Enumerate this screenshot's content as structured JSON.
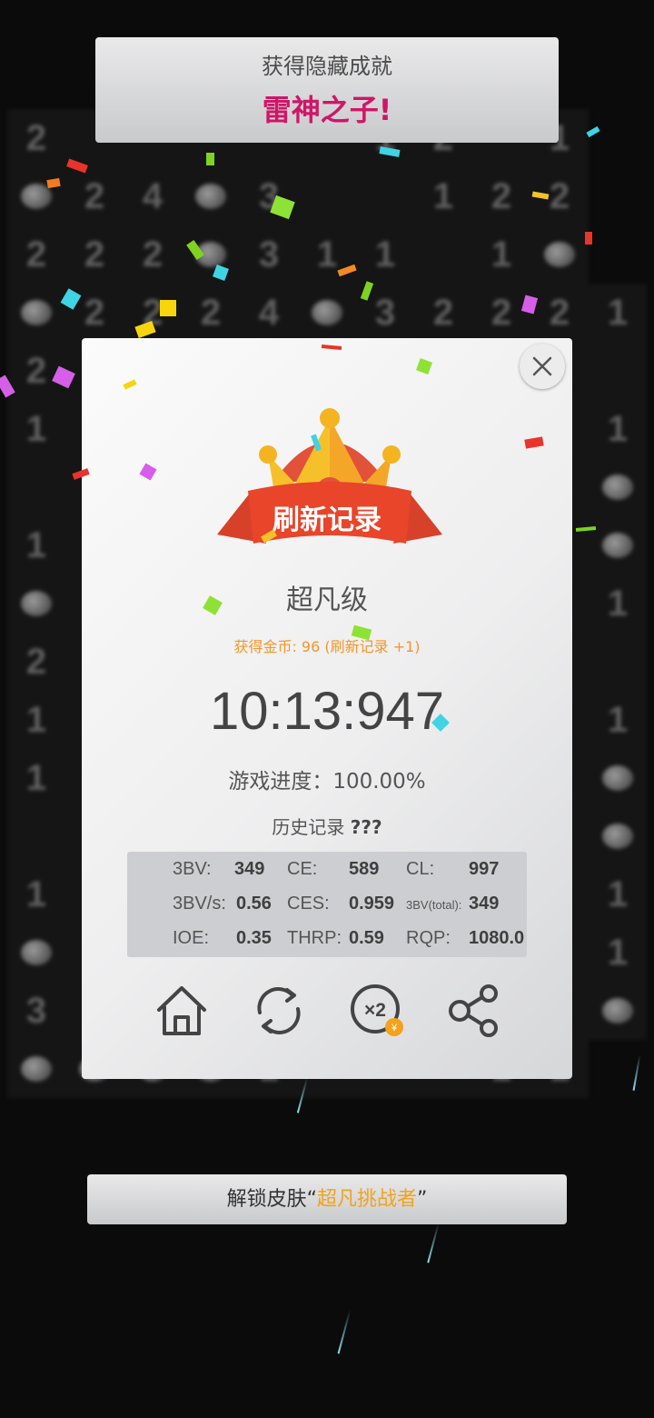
{
  "achievement_toast": {
    "heading": "获得隐藏成就",
    "title": "雷神之子!"
  },
  "result_dialog": {
    "badge_label": "刷新记录",
    "level": "超凡级",
    "coins": "获得金币: 96 (刷新记录 +1)",
    "time": "10:13:947",
    "progress": "游戏进度：100.00%",
    "history_label": "历史记录",
    "history_value": "???",
    "stats": {
      "bv_label": "3BV:",
      "bv": "349",
      "ce_label": "CE:",
      "ce": "589",
      "cl_label": "CL:",
      "cl": "997",
      "bvs_label": "3BV/s:",
      "bvs": "0.56",
      "ces_label": "CES:",
      "ces": "0.959",
      "bvt_label": "3BV(total):",
      "bvt": "349",
      "ioe_label": "IOE:",
      "ioe": "0.35",
      "thrp_label": "THRP:",
      "thrp": "0.59",
      "rqp_label": "RQP:",
      "rqp": "1080.0"
    },
    "x2_label": "×2",
    "coin_symbol": "¥"
  },
  "unlock_toast": {
    "prefix": "解锁皮肤“",
    "skin_name": "超凡挑战者",
    "suffix": "”"
  },
  "board": [
    "2 . . . . . 1 2 . 1",
    "m 2 4 m 3 . . 1 2 2",
    "2 2 2 m 3 1 1 . 1 m",
    "m 2 2 2 4 m 3 2 2 2 1",
    "2 . . . . . . . . . .",
    "1 . . . . . . . . . 1",
    ". . . . . . . . . . m",
    "1 . . . . . . . . . m",
    "m . . . . . . . . . 1",
    "2 . . . . . . . . . .",
    "1 . . . . . . . . . 1",
    "1 . . . . . . . . . m",
    ". . . . . . . . . . m",
    "1 . . . . . . . . . 1",
    "m . . . . . . . . . 1",
    "3 . . . . . . . . . m",
    "m m m m 1 . . . 1 1"
  ]
}
